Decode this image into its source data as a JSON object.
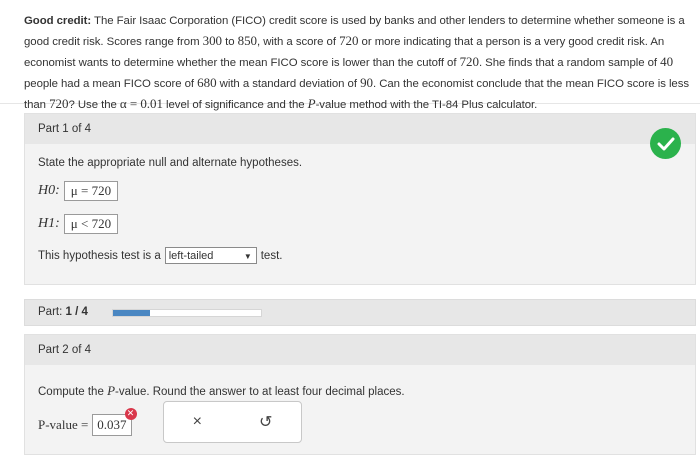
{
  "problem": {
    "title": "Good credit:",
    "text_1": "The Fair Isaac Corporation (FICO) credit score is used by banks and other lenders to determine whether someone is a good credit risk. Scores range from",
    "low": "300",
    "text_2": "to",
    "high": "850",
    "text_3": ", with a score of",
    "cutoff": "720",
    "text_4": "or more indicating that a person is a very good credit risk. An economist wants to determine whether the mean FICO score is lower than the cutoff of",
    "cutoff2": "720",
    "text_5": ". She finds that a random sample of",
    "n": "40",
    "text_6": "people had a mean FICO score of",
    "mean": "680",
    "text_7": "with a standard deviation of",
    "sd": "90",
    "text_8": ". Can the economist conclude that the mean FICO score is less than",
    "cutoff3": "720",
    "text_9": "? Use the",
    "alpha": "α = 0.01",
    "text_10": "level of significance and the",
    "pmethod": "P",
    "text_11": "-value method with the TI-84 Plus calculator."
  },
  "part1": {
    "header": "Part 1 of 4",
    "instruction": "State the appropriate null and alternate hypotheses.",
    "h0_symbol": "H0:",
    "h0_value": "μ = 720",
    "h1_symbol": "H1:",
    "h1_value": "μ < 720",
    "test_prefix": "This hypothesis test is a",
    "test_selected": "left-tailed",
    "test_suffix": "test."
  },
  "progress": {
    "label": "Part:",
    "value": "1 / 4",
    "fraction": 0.25
  },
  "part2": {
    "header": "Part 2 of 4",
    "instruction_1": "Compute the",
    "instruction_p": "P",
    "instruction_2": "-value. Round the answer to at least four decimal places.",
    "pvalue_label": "P-value =",
    "pvalue_input": "0.037"
  },
  "tools": {
    "clear": "×",
    "undo": "↺"
  },
  "colors": {
    "check": "#2bb24c",
    "progress_fill": "#4a87c2",
    "error": "#d9374b"
  }
}
